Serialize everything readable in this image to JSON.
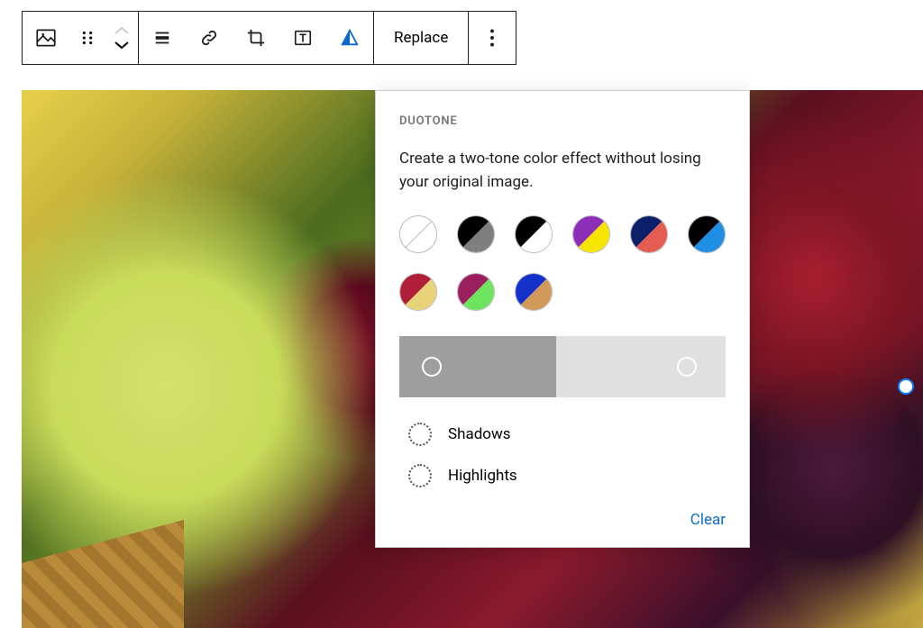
{
  "toolbar": {
    "replace_label": "Replace"
  },
  "duotone": {
    "title": "DUOTONE",
    "description": "Create a two-tone color effect without losing your original image.",
    "presets": [
      {
        "name": "none",
        "c1": null,
        "c2": null
      },
      {
        "name": "black-gray",
        "c1": "#000000",
        "c2": "#7f7f7f"
      },
      {
        "name": "black-white",
        "c1": "#000000",
        "c2": "#ffffff"
      },
      {
        "name": "purple-yellow",
        "c1": "#8c2eb8",
        "c2": "#f6e500"
      },
      {
        "name": "navy-red",
        "c1": "#0b1f6b",
        "c2": "#e45b4f"
      },
      {
        "name": "black-blue",
        "c1": "#000000",
        "c2": "#1f8fe6"
      },
      {
        "name": "crimson-sand",
        "c1": "#b01e3a",
        "c2": "#e8d27a"
      },
      {
        "name": "magenta-green",
        "c1": "#9b1e5e",
        "c2": "#6de35e"
      },
      {
        "name": "blue-tan",
        "c1": "#1431c9",
        "c2": "#d29a5a"
      }
    ],
    "gradient_stops": [
      10,
      88
    ],
    "shadows_label": "Shadows",
    "highlights_label": "Highlights",
    "clear_label": "Clear"
  }
}
